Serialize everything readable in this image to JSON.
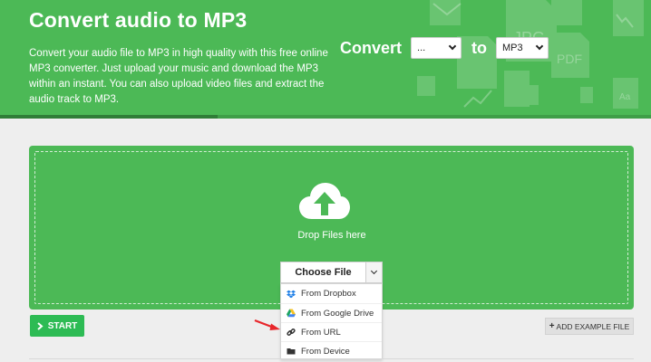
{
  "hero": {
    "title": "Convert audio to MP3",
    "description": "Convert your audio file to MP3 in high quality with this free online MP3 converter. Just upload your music and download the MP3 within an instant. You can also upload video files and extract the audio track to MP3.",
    "convert_label": "Convert",
    "from_value": "...",
    "to_label": "to",
    "to_value": "MP3",
    "background_icon_labels": [
      "JPG",
      "PDF",
      "Aa"
    ]
  },
  "upload": {
    "drop_text": "Drop Files here",
    "choose_file_label": "Choose File",
    "menu": [
      {
        "label": "From Dropbox",
        "icon": "dropbox-icon"
      },
      {
        "label": "From Google Drive",
        "icon": "google-drive-icon"
      },
      {
        "label": "From URL",
        "icon": "link-icon"
      },
      {
        "label": "From Device",
        "icon": "folder-icon"
      }
    ]
  },
  "actions": {
    "start_label": "START",
    "add_example_label": "ADD EXAMPLE FILE"
  },
  "colors": {
    "brand_green": "#4cb956",
    "start_green": "#2dbb54",
    "annotation_arrow": "#e8262b"
  }
}
